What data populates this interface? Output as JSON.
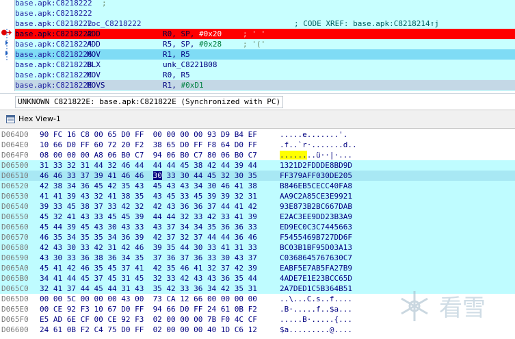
{
  "disasm": {
    "rows": [
      {
        "addr": "base.apk:C8218222",
        "label": "",
        "mnem": "",
        "ops": "",
        "cmt": ";",
        "style": ""
      },
      {
        "addr": "base.apk:C8218222",
        "label": "",
        "mnem": "",
        "ops": "",
        "cmt": "",
        "style": ""
      },
      {
        "addr": "base.apk:C8218222",
        "label": "loc_C8218222",
        "mnem": "",
        "ops": "",
        "cmt": "; CODE XREF: base.apk:C8218214↑j",
        "style": "xref"
      },
      {
        "addr": "base.apk:C8218222",
        "label": "",
        "mnem": "ADD",
        "ops": "R0, SP, ",
        "num": "#0x20",
        "cmt": "; ' '",
        "style": "red"
      },
      {
        "addr": "base.apk:C8218224",
        "label": "",
        "mnem": "ADD",
        "ops": "R5, SP, ",
        "num": "#0x28",
        "cmt": "; '('",
        "style": ""
      },
      {
        "addr": "base.apk:C8218226",
        "label": "",
        "mnem": "MOV",
        "ops": "R1, R5",
        "num": "",
        "cmt": "",
        "style": "cur"
      },
      {
        "addr": "base.apk:C8218228",
        "label": "",
        "mnem": "BLX",
        "ops": "unk_C8221B08",
        "num": "",
        "cmt": "",
        "style": ""
      },
      {
        "addr": "base.apk:C821822C",
        "label": "",
        "mnem": "MOV",
        "ops": "R0, R5",
        "num": "",
        "cmt": "",
        "style": ""
      },
      {
        "addr": "base.apk:C821822E",
        "label": "",
        "mnem": "MOVS",
        "ops": "R1, ",
        "num": "#0xD1",
        "cmt": "",
        "style": "grey"
      }
    ],
    "status_text": "UNKNOWN C821822E: base.apk:C821822E (Synchronized with PC)"
  },
  "hex_view": {
    "title": "Hex View-1",
    "rows": [
      {
        "addr": "D064D0",
        "bytes": "90 FC 16 C8 00 65 D0 FF  00 00 00 00 93 D9 B4 EF",
        "ascii": ".....e.......'."
      },
      {
        "addr": "D064E0",
        "bytes": "10 66 D0 FF 60 72 20 F2  38 65 D0 FF F8 64 D0 FF",
        "ascii": ".f..`r·.......d.."
      },
      {
        "addr": "D064F0",
        "bytes": "08 00 00 00 A8 06 B0 C7  94 06 B0 C7 80 06 B0 C7",
        "ascii_hl": "......",
        "ascii": "..ü··|·..."
      },
      {
        "addr": "D06500",
        "bytes": "31 33 32 31 44 32 46 44  44 44 45 38 42 44 39 44",
        "ascii": "1321D2FDDDE8BD9D"
      },
      {
        "addr": "D06510",
        "bytes_cur": "30",
        "bytes_pre": "46 46 33 37 39 41 46 46  ",
        "bytes_post": " 33 30 44 45 32 30 35",
        "ascii": "FF379AFF030DE205",
        "style": "sel"
      },
      {
        "addr": "D06520",
        "bytes": "42 38 34 36 45 42 35 43  45 43 43 34 30 46 41 38",
        "ascii": "B846EB5CECC40FA8"
      },
      {
        "addr": "D06530",
        "bytes": "41 41 39 43 32 41 38 35  43 45 33 45 39 39 32 31",
        "ascii": "AA9C2A85CE3E9921"
      },
      {
        "addr": "D06540",
        "bytes": "39 33 45 38 37 33 42 32  42 43 36 36 37 44 41 42",
        "ascii": "93E873B2BC667DAB"
      },
      {
        "addr": "D06550",
        "bytes": "45 32 41 43 33 45 45 39  44 44 32 33 42 33 41 39",
        "ascii": "E2AC3EE9DD23B3A9"
      },
      {
        "addr": "D06560",
        "bytes": "45 44 39 45 43 30 43 33  43 37 34 34 35 36 36 33",
        "ascii": "ED9EC0C3C7445663"
      },
      {
        "addr": "D06570",
        "bytes": "46 35 34 35 35 34 36 39  42 37 32 37 44 44 36 46",
        "ascii": "F5455469B727DD6F"
      },
      {
        "addr": "D06580",
        "bytes": "42 43 30 33 42 31 42 46  39 35 44 30 33 41 31 33",
        "ascii": "BC03B1BF95D03A13"
      },
      {
        "addr": "D06590",
        "bytes": "43 30 33 36 38 36 34 35  37 36 37 36 33 30 43 37",
        "ascii": "C0368645767630C7"
      },
      {
        "addr": "D065A0",
        "bytes": "45 41 42 46 35 45 37 41  42 35 46 41 32 37 42 39",
        "ascii": "EABF5E7AB5FA27B9"
      },
      {
        "addr": "D065B0",
        "bytes": "34 41 44 45 37 45 31 45  32 33 42 43 43 36 35 44",
        "ascii": "4ADE7E1E23BCC65D"
      },
      {
        "addr": "D065C0",
        "bytes": "32 41 37 44 45 44 31 43  35 42 33 36 34 42 35 31",
        "ascii": "2A7DED1C5B364B51"
      },
      {
        "addr": "D065D0",
        "bytes": "00 00 5C 00 00 00 43 00  73 CA 12 66 00 00 00 00",
        "ascii": "..\\...C.s..f...."
      },
      {
        "addr": "D065E0",
        "bytes": "00 CE 92 F3 10 67 D0 FF  94 66 D0 FF 24 61 0B F2",
        "ascii": ".B·.....f..$a..."
      },
      {
        "addr": "D065F0",
        "bytes": "E5 AD 6E CF 00 CE 92 F3  02 00 00 00 7B F0 4C CF",
        "ascii": ".....B·.....{..."
      },
      {
        "addr": "D06600",
        "bytes": "24 61 0B F2 C4 75 D0 FF  02 00 00 00 40 1D C6 12",
        "ascii": "$a.........@...."
      }
    ]
  },
  "watermark": {
    "text": "看雪"
  }
}
